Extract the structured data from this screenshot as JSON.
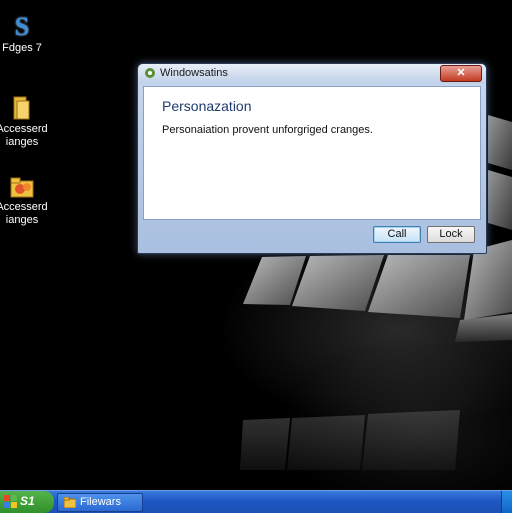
{
  "desktop": {
    "icons": [
      {
        "label": "Fdges 7",
        "icon": "s-icon"
      },
      {
        "label": "Accesserd\nianges",
        "icon": "folder-icon"
      },
      {
        "label": "Accesserd\nianges",
        "icon": "settings-folder-icon"
      }
    ]
  },
  "dialog": {
    "title": "Windowsatins",
    "close_label": "✕",
    "heading": "Personazation",
    "message": "Personaiation provent unforgriged cranges.",
    "buttons": {
      "call": "Call",
      "lock": "Lock"
    }
  },
  "taskbar": {
    "start_label": "S1",
    "items": [
      {
        "label": "Filewars",
        "icon": "explorer-icon"
      }
    ]
  },
  "colors": {
    "taskbar": "#1f57c3",
    "start": "#2f8f2a",
    "close": "#c23b22",
    "heading": "#1f3b6e"
  }
}
